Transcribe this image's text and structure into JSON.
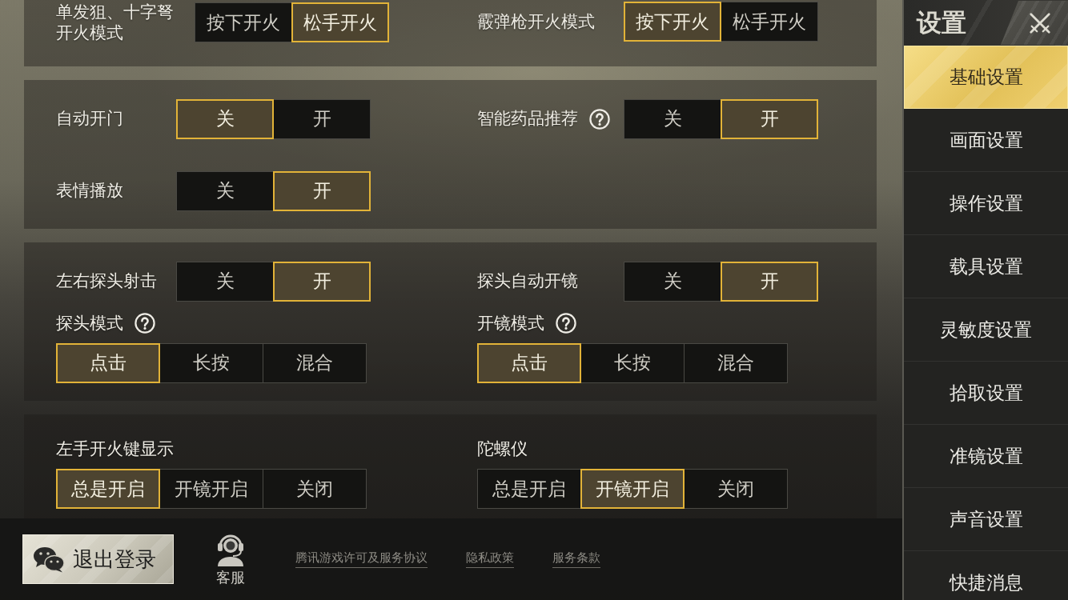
{
  "sections": [
    {
      "settings": [
        {
          "kind": "inline",
          "label": "单发狙、十字弩开火模式",
          "help": false,
          "options": [
            {
              "label": "按下开火",
              "selected": false
            },
            {
              "label": "松手开火",
              "selected": true
            }
          ]
        },
        {
          "kind": "inline",
          "label": "霰弹枪开火模式",
          "help": false,
          "options": [
            {
              "label": "按下开火",
              "selected": true
            },
            {
              "label": "松手开火",
              "selected": false
            }
          ]
        }
      ]
    },
    {
      "settings": [
        {
          "kind": "inline",
          "label": "自动开门",
          "help": false,
          "options": [
            {
              "label": "关",
              "selected": true
            },
            {
              "label": "开",
              "selected": false
            }
          ]
        },
        {
          "kind": "inline",
          "label": "智能药品推荐",
          "help": true,
          "options": [
            {
              "label": "关",
              "selected": false
            },
            {
              "label": "开",
              "selected": true
            }
          ]
        },
        {
          "kind": "inline",
          "label": "表情播放",
          "help": false,
          "options": [
            {
              "label": "关",
              "selected": false
            },
            {
              "label": "开",
              "selected": true
            }
          ]
        }
      ]
    },
    {
      "settings": [
        {
          "kind": "inline",
          "label": "左右探头射击",
          "help": false,
          "options": [
            {
              "label": "关",
              "selected": false
            },
            {
              "label": "开",
              "selected": true
            }
          ]
        },
        {
          "kind": "inline",
          "label": "探头自动开镜",
          "help": false,
          "options": [
            {
              "label": "关",
              "selected": false
            },
            {
              "label": "开",
              "selected": true
            }
          ]
        },
        {
          "kind": "stacked",
          "label": "探头模式",
          "help": true,
          "options": [
            {
              "label": "点击",
              "selected": true
            },
            {
              "label": "长按",
              "selected": false
            },
            {
              "label": "混合",
              "selected": false
            }
          ]
        },
        {
          "kind": "stacked",
          "label": "开镜模式",
          "help": true,
          "options": [
            {
              "label": "点击",
              "selected": true
            },
            {
              "label": "长按",
              "selected": false
            },
            {
              "label": "混合",
              "selected": false
            }
          ]
        }
      ]
    },
    {
      "settings": [
        {
          "kind": "stacked",
          "label": "左手开火键显示",
          "help": false,
          "options": [
            {
              "label": "总是开启",
              "selected": true
            },
            {
              "label": "开镜开启",
              "selected": false
            },
            {
              "label": "关闭",
              "selected": false
            }
          ]
        },
        {
          "kind": "stacked",
          "label": "陀螺仪",
          "help": false,
          "options": [
            {
              "label": "总是开启",
              "selected": false
            },
            {
              "label": "开镜开启",
              "selected": true
            },
            {
              "label": "关闭",
              "selected": false
            }
          ]
        }
      ]
    }
  ],
  "footer": {
    "logout_button": "退出登录",
    "support": "客服",
    "links": [
      "腾讯游戏许可及服务协议",
      "隐私政策",
      "服务条款"
    ]
  },
  "sidebar": {
    "title": "设置",
    "items": [
      {
        "label": "基础设置",
        "selected": true
      },
      {
        "label": "画面设置",
        "selected": false
      },
      {
        "label": "操作设置",
        "selected": false
      },
      {
        "label": "载具设置",
        "selected": false
      },
      {
        "label": "灵敏度设置",
        "selected": false
      },
      {
        "label": "拾取设置",
        "selected": false
      },
      {
        "label": "准镜设置",
        "selected": false
      },
      {
        "label": "声音设置",
        "selected": false
      },
      {
        "label": "快捷消息",
        "selected": false
      }
    ]
  }
}
